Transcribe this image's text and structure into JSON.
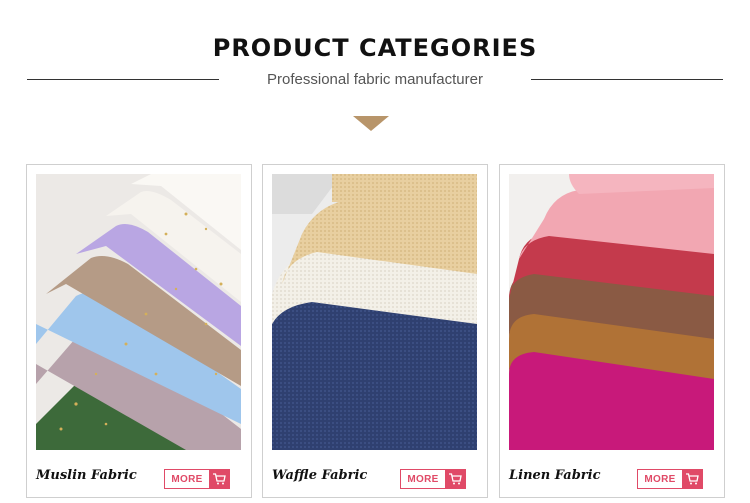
{
  "header": {
    "title": "PRODUCT CATEGORIES",
    "subtitle": "Professional fabric manufacturer"
  },
  "colors": {
    "accent": "#e04a67",
    "arrow": "#b8956a",
    "text": "#111111"
  },
  "categories": [
    {
      "label": "Muslin Fabric",
      "button": "MORE",
      "icon": "cart-icon"
    },
    {
      "label": "Waffle Fabric",
      "button": "MORE",
      "icon": "cart-icon"
    },
    {
      "label": "Linen Fabric",
      "button": "MORE",
      "icon": "cart-icon"
    }
  ]
}
